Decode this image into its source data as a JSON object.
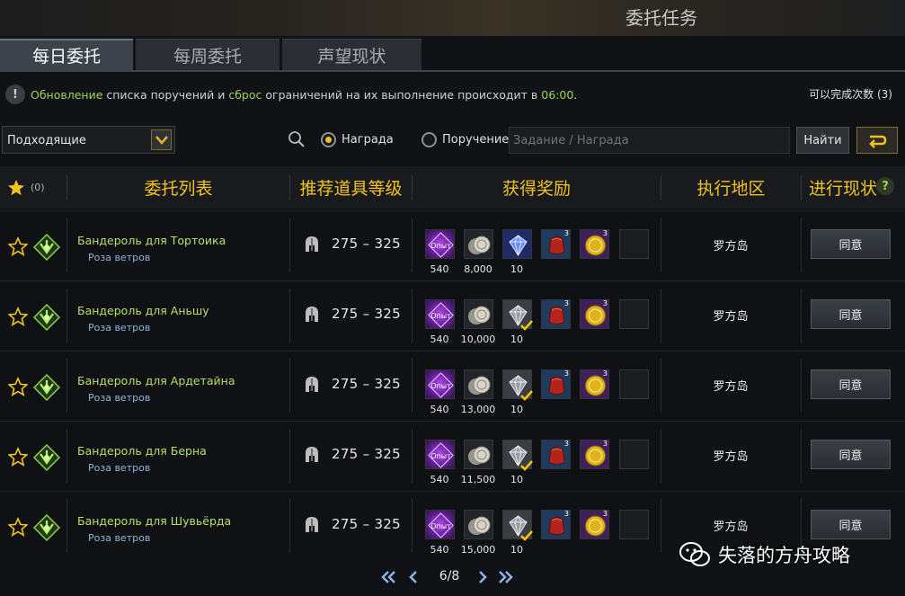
{
  "window": {
    "title": "委托任务"
  },
  "tabs": [
    {
      "label": "每日委托",
      "active": true
    },
    {
      "label": "每周委托",
      "active": false
    },
    {
      "label": "声望现状",
      "active": false
    }
  ],
  "notice": {
    "w1": "Обновление",
    "t1": " списка поручений и ",
    "w2": "сброс",
    "t2": " ограничений на их выполнение происходит в ",
    "w3": "06:00",
    "t3": ".",
    "remaining": "可以完成次数 (3)"
  },
  "filter": {
    "selected": "Подходящие",
    "radio_reward": "Награда",
    "radio_task": "Поручение",
    "search_placeholder": "Задание / Награда",
    "search_button": "Найти"
  },
  "table": {
    "headers": {
      "star_count": "(0)",
      "task_list": "委托列表",
      "item_level": "推荐道具等级",
      "rewards": "获得奖励",
      "region": "执行地区",
      "progress": "进行现状"
    },
    "rows": [
      {
        "name": "Бандероль для Тортоика",
        "sub": "Роза ветров",
        "level": "275 – 325",
        "exp": "540",
        "silver": "8,000",
        "gem": "10",
        "gem_done": false,
        "pouch_count": "3",
        "gold_count": "3",
        "region": "罗方岛",
        "action": "同意"
      },
      {
        "name": "Бандероль для Аньшу",
        "sub": "Роза ветров",
        "level": "275 – 325",
        "exp": "540",
        "silver": "10,000",
        "gem": "10",
        "gem_done": true,
        "pouch_count": "3",
        "gold_count": "3",
        "region": "罗方岛",
        "action": "同意"
      },
      {
        "name": "Бандероль для Ардетайна",
        "sub": "Роза ветров",
        "level": "275 – 325",
        "exp": "540",
        "silver": "13,000",
        "gem": "10",
        "gem_done": true,
        "pouch_count": "3",
        "gold_count": "3",
        "region": "罗方岛",
        "action": "同意"
      },
      {
        "name": "Бандероль для Берна",
        "sub": "Роза ветров",
        "level": "275 – 325",
        "exp": "540",
        "silver": "11,500",
        "gem": "10",
        "gem_done": true,
        "pouch_count": "3",
        "gold_count": "3",
        "region": "罗方岛",
        "action": "同意"
      },
      {
        "name": "Бандероль для Шувьёрда",
        "sub": "Роза ветров",
        "level": "275 – 325",
        "exp": "540",
        "silver": "15,000",
        "gem": "10",
        "gem_done": true,
        "pouch_count": "3",
        "gold_count": "3",
        "region": "罗方岛",
        "action": "同意"
      }
    ]
  },
  "pager": {
    "text": "6/8"
  },
  "watermark": {
    "text": "失落的方舟攻略"
  },
  "colors": {
    "accent": "#f2c31c",
    "highlight": "#9fd35a",
    "task_name": "#b6e06a"
  }
}
